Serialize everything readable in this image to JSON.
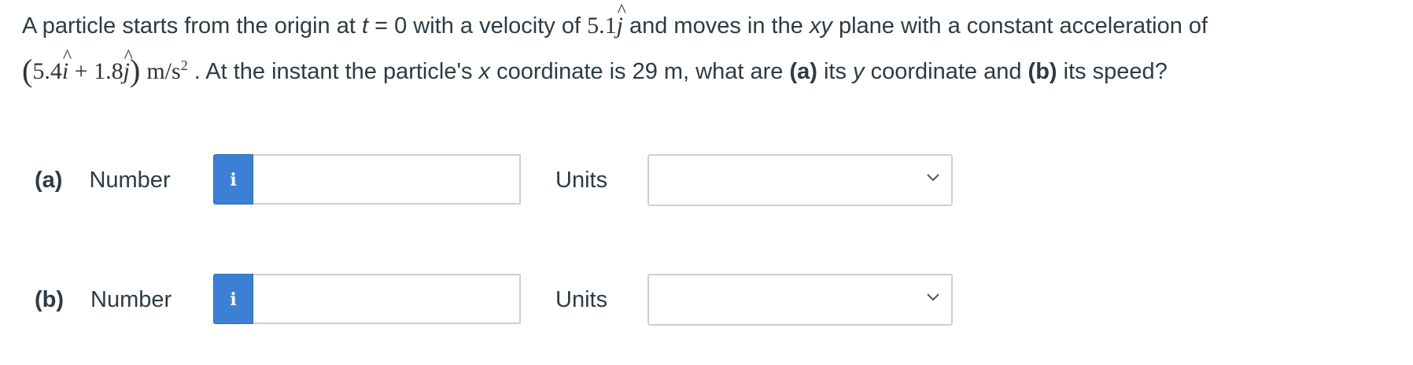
{
  "problem": {
    "p1": "A particle starts from the origin at ",
    "t_var": "t",
    "p2": " = 0 with a velocity of ",
    "v_coef": "5.1",
    "j_hat": "j",
    "p3": " and moves in the ",
    "xy_var": "xy",
    "p4": " plane with a constant acceleration of",
    "paren_open": "(",
    "a_coef1": "5.4",
    "i_hat": "i",
    "plus": " + ",
    "a_coef2": "1.8",
    "j_hat2": "j",
    "paren_close": ")",
    "unit_base": "m/s",
    "unit_exp": "2",
    "p5": " . At the instant the particle's ",
    "x_var": "x",
    "p6": " coordinate is 29 m, what are ",
    "a_mark": "(a)",
    "p7": " its ",
    "y_var": "y",
    "p8": " coordinate and ",
    "b_mark": "(b)",
    "p9": " its speed?"
  },
  "answers": [
    {
      "part": "(a)",
      "number_label": "Number",
      "info_icon": "i",
      "number_value": "",
      "units_label": "Units",
      "units_value": ""
    },
    {
      "part": "(b)",
      "number_label": "Number",
      "info_icon": "i",
      "number_value": "",
      "units_label": "Units",
      "units_value": ""
    }
  ],
  "colors": {
    "info_button": "#3c80d6",
    "text": "#2d3b45",
    "border": "#cfcfcf"
  },
  "icons": {
    "info": "info-icon",
    "dropdown": "chevron-down-icon"
  }
}
